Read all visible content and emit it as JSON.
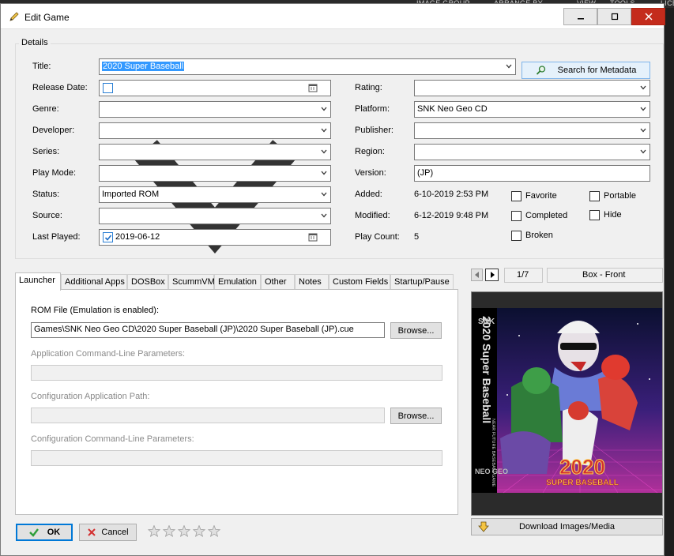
{
  "menubar": {
    "image_group": "IMAGE GROUP",
    "arrange_by": "ARRANGE BY",
    "view": "VIEW",
    "tools": "TOOLS",
    "lic": "LICE"
  },
  "window": {
    "title": "Edit Game"
  },
  "details": {
    "legend": "Details",
    "title_label": "Title:",
    "title_value": "2020 Super Baseball",
    "search_metadata": "Search for Metadata",
    "release_date_label": "Release Date:",
    "rating_label": "Rating:",
    "genre_label": "Genre:",
    "platform_label": "Platform:",
    "platform_value": "SNK Neo Geo CD",
    "developer_label": "Developer:",
    "publisher_label": "Publisher:",
    "series_label": "Series:",
    "region_label": "Region:",
    "play_mode_label": "Play Mode:",
    "version_label": "Version:",
    "version_value": "(JP)",
    "status_label": "Status:",
    "status_value": "Imported ROM",
    "added_label": "Added:",
    "added_value": "6-10-2019 2:53 PM",
    "source_label": "Source:",
    "modified_label": "Modified:",
    "modified_value": "6-12-2019 9:48 PM",
    "last_played_label": "Last Played:",
    "last_played_value": "2019-06-12",
    "play_count_label": "Play Count:",
    "play_count_value": "5",
    "favorite": "Favorite",
    "portable": "Portable",
    "completed": "Completed",
    "hide": "Hide",
    "broken": "Broken"
  },
  "tabs": [
    "Launcher",
    "Additional Apps",
    "DOSBox",
    "ScummVM",
    "Emulation",
    "Other",
    "Notes",
    "Custom Fields",
    "Startup/Pause"
  ],
  "launcher": {
    "rom_label": "ROM File (Emulation is enabled):",
    "rom_value": "Games\\SNK Neo Geo CD\\2020 Super Baseball (JP)\\2020 Super Baseball (JP).cue",
    "browse": "Browse...",
    "app_cmd_label": "Application Command-Line Parameters:",
    "config_path_label": "Configuration Application Path:",
    "config_cmd_label": "Configuration Command-Line Parameters:"
  },
  "image_panel": {
    "counter": "1/7",
    "image_type": "Box - Front",
    "download": "Download Images/Media",
    "cover": {
      "side_title": "2020 Super Baseball",
      "side_sub": "NEAR FUTURE BASEBALL GAME",
      "brand": "SNK",
      "brand2": "NEO GEO",
      "logo_year": "2020",
      "logo_text": "SUPER BASEBALL"
    }
  },
  "footer": {
    "ok": "OK",
    "cancel": "Cancel",
    "rating_stars": 0
  }
}
